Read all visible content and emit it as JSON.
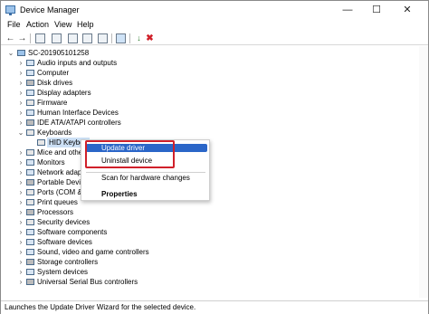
{
  "window": {
    "title": "Device Manager"
  },
  "menu": [
    "File",
    "Action",
    "View",
    "Help"
  ],
  "toolbar": [
    "back-icon",
    "forward-icon",
    "properties-icon",
    "help-icon",
    "show-hidden-icon",
    "monitor-icon",
    "update-driver-icon",
    "uninstall-icon"
  ],
  "tree": {
    "root": "SC-201905101258",
    "items": [
      "Audio inputs and outputs",
      "Computer",
      "Disk drives",
      "Display adapters",
      "Firmware",
      "Human Interface Devices",
      "IDE ATA/ATAPI controllers",
      "Keyboards",
      "HID Keyboa",
      "Mice and other",
      "Monitors",
      "Network adapte",
      "Portable Device",
      "Ports (COM & L",
      "Print queues",
      "Processors",
      "Security devices",
      "Software components",
      "Software devices",
      "Sound, video and game controllers",
      "Storage controllers",
      "System devices",
      "Universal Serial Bus controllers"
    ]
  },
  "context_menu": {
    "items": [
      "Update driver",
      "Uninstall device",
      "Scan for hardware changes",
      "Properties"
    ]
  },
  "status": "Launches the Update Driver Wizard for the selected device.",
  "colors": {
    "highlight": "#2b66c8",
    "annotation": "#d0202a",
    "selection": "#cce0f5"
  }
}
